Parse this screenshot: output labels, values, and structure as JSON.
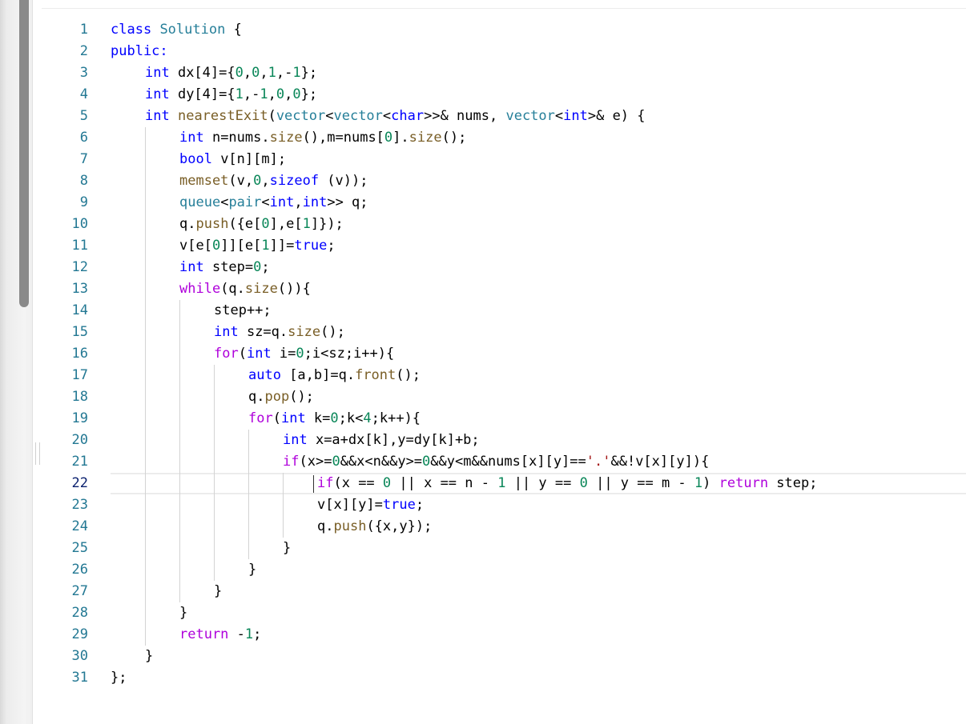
{
  "editor": {
    "language": "cpp",
    "active_line": 22,
    "colors": {
      "line_number": "#237893",
      "active_line_number": "#0b216f",
      "keyword": "#0000ff",
      "control_keyword": "#af00db",
      "function": "#795e26",
      "type": "#267f99",
      "number": "#098658",
      "string": "#a31515",
      "text": "#000000"
    },
    "lines": [
      {
        "number": "1",
        "indent": 0,
        "tokens": [
          {
            "t": "class",
            "c": "kw"
          },
          {
            "t": " "
          },
          {
            "t": "Solution",
            "c": "ty"
          },
          {
            "t": " {"
          }
        ]
      },
      {
        "number": "2",
        "indent": 0,
        "tokens": [
          {
            "t": "public:",
            "c": "kw"
          }
        ]
      },
      {
        "number": "3",
        "indent": 1,
        "tokens": [
          {
            "t": "int",
            "c": "kw"
          },
          {
            "t": " dx[4]={"
          },
          {
            "t": "0",
            "c": "num"
          },
          {
            "t": ","
          },
          {
            "t": "0",
            "c": "num"
          },
          {
            "t": ","
          },
          {
            "t": "1",
            "c": "num"
          },
          {
            "t": ",-"
          },
          {
            "t": "1",
            "c": "num"
          },
          {
            "t": "};"
          }
        ]
      },
      {
        "number": "4",
        "indent": 1,
        "tokens": [
          {
            "t": "int",
            "c": "kw"
          },
          {
            "t": " dy[4]={"
          },
          {
            "t": "1",
            "c": "num"
          },
          {
            "t": ",-"
          },
          {
            "t": "1",
            "c": "num"
          },
          {
            "t": ","
          },
          {
            "t": "0",
            "c": "num"
          },
          {
            "t": ","
          },
          {
            "t": "0",
            "c": "num"
          },
          {
            "t": "};"
          }
        ]
      },
      {
        "number": "5",
        "indent": 1,
        "tokens": [
          {
            "t": "int",
            "c": "kw"
          },
          {
            "t": " "
          },
          {
            "t": "nearestExit",
            "c": "fn"
          },
          {
            "t": "("
          },
          {
            "t": "vector",
            "c": "ty"
          },
          {
            "t": "<"
          },
          {
            "t": "vector",
            "c": "ty"
          },
          {
            "t": "<"
          },
          {
            "t": "char",
            "c": "kw"
          },
          {
            "t": ">>& nums, "
          },
          {
            "t": "vector",
            "c": "ty"
          },
          {
            "t": "<"
          },
          {
            "t": "int",
            "c": "kw"
          },
          {
            "t": ">& e) {"
          }
        ]
      },
      {
        "number": "6",
        "indent": 2,
        "tokens": [
          {
            "t": "int",
            "c": "kw"
          },
          {
            "t": " n=nums."
          },
          {
            "t": "size",
            "c": "fn"
          },
          {
            "t": "(),m=nums["
          },
          {
            "t": "0",
            "c": "num"
          },
          {
            "t": "]."
          },
          {
            "t": "size",
            "c": "fn"
          },
          {
            "t": "();"
          }
        ]
      },
      {
        "number": "7",
        "indent": 2,
        "tokens": [
          {
            "t": "bool",
            "c": "kw"
          },
          {
            "t": " v[n][m];"
          }
        ]
      },
      {
        "number": "8",
        "indent": 2,
        "tokens": [
          {
            "t": "memset",
            "c": "fn"
          },
          {
            "t": "(v,"
          },
          {
            "t": "0",
            "c": "num"
          },
          {
            "t": ","
          },
          {
            "t": "sizeof",
            "c": "kw"
          },
          {
            "t": " (v));"
          }
        ]
      },
      {
        "number": "9",
        "indent": 2,
        "tokens": [
          {
            "t": "queue",
            "c": "ty"
          },
          {
            "t": "<"
          },
          {
            "t": "pair",
            "c": "ty"
          },
          {
            "t": "<"
          },
          {
            "t": "int",
            "c": "kw"
          },
          {
            "t": ","
          },
          {
            "t": "int",
            "c": "kw"
          },
          {
            "t": ">> q;"
          }
        ]
      },
      {
        "number": "10",
        "indent": 2,
        "tokens": [
          {
            "t": "q."
          },
          {
            "t": "push",
            "c": "fn"
          },
          {
            "t": "({e["
          },
          {
            "t": "0",
            "c": "num"
          },
          {
            "t": "],e["
          },
          {
            "t": "1",
            "c": "num"
          },
          {
            "t": "]});"
          }
        ]
      },
      {
        "number": "11",
        "indent": 2,
        "tokens": [
          {
            "t": "v[e["
          },
          {
            "t": "0",
            "c": "num"
          },
          {
            "t": "]][e["
          },
          {
            "t": "1",
            "c": "num"
          },
          {
            "t": "]]="
          },
          {
            "t": "true",
            "c": "kw"
          },
          {
            "t": ";"
          }
        ]
      },
      {
        "number": "12",
        "indent": 2,
        "tokens": [
          {
            "t": "int",
            "c": "kw"
          },
          {
            "t": " step="
          },
          {
            "t": "0",
            "c": "num"
          },
          {
            "t": ";"
          }
        ]
      },
      {
        "number": "13",
        "indent": 2,
        "tokens": [
          {
            "t": "while",
            "c": "ctl"
          },
          {
            "t": "(q."
          },
          {
            "t": "size",
            "c": "fn"
          },
          {
            "t": "()){"
          }
        ]
      },
      {
        "number": "14",
        "indent": 3,
        "tokens": [
          {
            "t": "step++;"
          }
        ]
      },
      {
        "number": "15",
        "indent": 3,
        "tokens": [
          {
            "t": "int",
            "c": "kw"
          },
          {
            "t": " sz=q."
          },
          {
            "t": "size",
            "c": "fn"
          },
          {
            "t": "();"
          }
        ]
      },
      {
        "number": "16",
        "indent": 3,
        "tokens": [
          {
            "t": "for",
            "c": "ctl"
          },
          {
            "t": "("
          },
          {
            "t": "int",
            "c": "kw"
          },
          {
            "t": " i="
          },
          {
            "t": "0",
            "c": "num"
          },
          {
            "t": ";i<sz;i++){"
          }
        ]
      },
      {
        "number": "17",
        "indent": 4,
        "tokens": [
          {
            "t": "auto",
            "c": "kw"
          },
          {
            "t": " [a,b]=q."
          },
          {
            "t": "front",
            "c": "fn"
          },
          {
            "t": "();"
          }
        ]
      },
      {
        "number": "18",
        "indent": 4,
        "tokens": [
          {
            "t": "q."
          },
          {
            "t": "pop",
            "c": "fn"
          },
          {
            "t": "();"
          }
        ]
      },
      {
        "number": "19",
        "indent": 4,
        "tokens": [
          {
            "t": "for",
            "c": "ctl"
          },
          {
            "t": "("
          },
          {
            "t": "int",
            "c": "kw"
          },
          {
            "t": " k="
          },
          {
            "t": "0",
            "c": "num"
          },
          {
            "t": ";k<"
          },
          {
            "t": "4",
            "c": "num"
          },
          {
            "t": ";k++){"
          }
        ]
      },
      {
        "number": "20",
        "indent": 5,
        "tokens": [
          {
            "t": "int",
            "c": "kw"
          },
          {
            "t": " x=a+dx[k],y=dy[k]+b;"
          }
        ]
      },
      {
        "number": "21",
        "indent": 5,
        "tokens": [
          {
            "t": "if",
            "c": "ctl"
          },
          {
            "t": "(x>="
          },
          {
            "t": "0",
            "c": "num"
          },
          {
            "t": "&&x<n&&y>="
          },
          {
            "t": "0",
            "c": "num"
          },
          {
            "t": "&&y<m&&nums[x][y]=="
          },
          {
            "t": "'.'",
            "c": "str"
          },
          {
            "t": "&&!v[x][y]){"
          }
        ]
      },
      {
        "number": "22",
        "indent": 6,
        "tokens": [
          {
            "t": "if",
            "c": "ctl"
          },
          {
            "t": "(x == "
          },
          {
            "t": "0",
            "c": "num"
          },
          {
            "t": " || x == n - "
          },
          {
            "t": "1",
            "c": "num"
          },
          {
            "t": " || y == "
          },
          {
            "t": "0",
            "c": "num"
          },
          {
            "t": " || y == m - "
          },
          {
            "t": "1",
            "c": "num"
          },
          {
            "t": ") "
          },
          {
            "t": "return",
            "c": "ctl"
          },
          {
            "t": " step;"
          }
        ]
      },
      {
        "number": "23",
        "indent": 6,
        "tokens": [
          {
            "t": "v[x][y]="
          },
          {
            "t": "true",
            "c": "kw"
          },
          {
            "t": ";"
          }
        ]
      },
      {
        "number": "24",
        "indent": 6,
        "tokens": [
          {
            "t": "q."
          },
          {
            "t": "push",
            "c": "fn"
          },
          {
            "t": "({x,y});"
          }
        ]
      },
      {
        "number": "25",
        "indent": 5,
        "tokens": [
          {
            "t": "}"
          }
        ]
      },
      {
        "number": "26",
        "indent": 4,
        "tokens": [
          {
            "t": "}"
          }
        ]
      },
      {
        "number": "27",
        "indent": 3,
        "tokens": [
          {
            "t": "}"
          }
        ]
      },
      {
        "number": "28",
        "indent": 2,
        "tokens": [
          {
            "t": "}"
          }
        ]
      },
      {
        "number": "29",
        "indent": 2,
        "tokens": [
          {
            "t": "return",
            "c": "ctl"
          },
          {
            "t": " -"
          },
          {
            "t": "1",
            "c": "num"
          },
          {
            "t": ";"
          }
        ]
      },
      {
        "number": "30",
        "indent": 1,
        "tokens": [
          {
            "t": "}"
          }
        ]
      },
      {
        "number": "31",
        "indent": 0,
        "tokens": [
          {
            "t": "};"
          }
        ]
      }
    ]
  }
}
